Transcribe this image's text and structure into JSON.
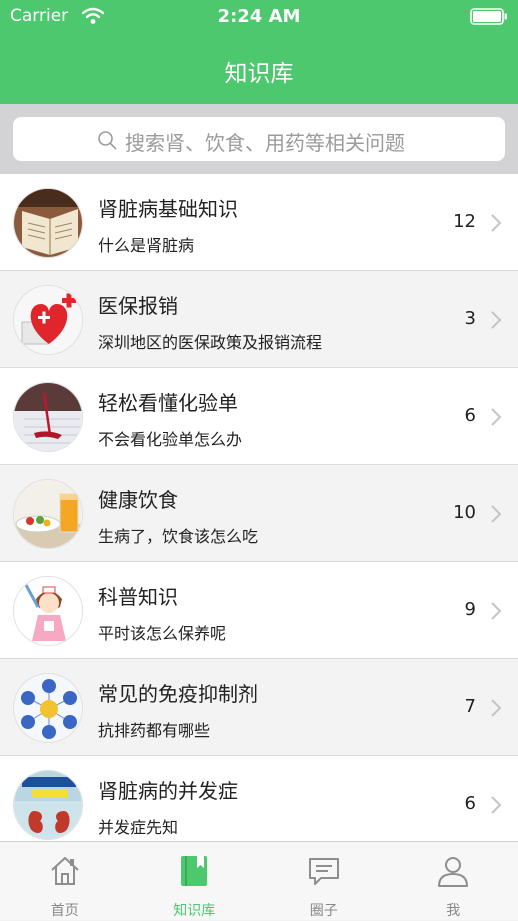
{
  "status_bar": {
    "carrier": "Carrier",
    "time": "2:24 AM"
  },
  "nav": {
    "title": "知识库"
  },
  "search": {
    "placeholder": "搜索肾、饮食、用药等相关问题"
  },
  "list": {
    "items": [
      {
        "title": "肾脏病基础知识",
        "subtitle": "什么是肾脏病",
        "count": "12",
        "thumb": "book-image"
      },
      {
        "title": "医保报销",
        "subtitle": "深圳地区的医保政策及报销流程",
        "count": "3",
        "thumb": "medical-heart-image"
      },
      {
        "title": "轻松看懂化验单",
        "subtitle": "不会看化验单怎么办",
        "count": "6",
        "thumb": "lab-test-image"
      },
      {
        "title": "健康饮食",
        "subtitle": "生病了，饮食该怎么吃",
        "count": "10",
        "thumb": "healthy-food-image"
      },
      {
        "title": "科普知识",
        "subtitle": "平时该怎么保养呢",
        "count": "9",
        "thumb": "nurse-image"
      },
      {
        "title": "常见的免疫抑制剂",
        "subtitle": "抗排药都有哪些",
        "count": "7",
        "thumb": "diagram-image"
      },
      {
        "title": "肾脏病的并发症",
        "subtitle": "并发症先知",
        "count": "6",
        "thumb": "kidney-book-image"
      }
    ]
  },
  "tabbar": {
    "tabs": [
      {
        "label": "首页",
        "icon": "home-icon"
      },
      {
        "label": "知识库",
        "icon": "bookmark-book-icon"
      },
      {
        "label": "圈子",
        "icon": "chat-bubble-icon"
      },
      {
        "label": "我",
        "icon": "person-icon"
      }
    ],
    "active_index": 1
  },
  "colors": {
    "accent": "#4ec86f",
    "search_bg": "#d3d3d6",
    "alt_row": "#f3f3f3"
  }
}
